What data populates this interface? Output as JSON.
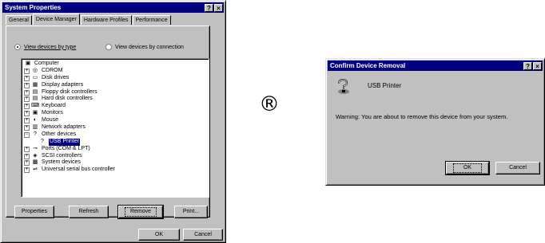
{
  "system_properties": {
    "title": "System Properties",
    "titlebar_buttons": [
      "?",
      "×"
    ],
    "tabs": [
      "General",
      "Device Manager",
      "Hardware Profiles",
      "Performance"
    ],
    "view_options": [
      {
        "label": "View devices by type",
        "checked": true
      },
      {
        "label": "View devices by connection",
        "checked": false
      }
    ],
    "tree": [
      {
        "label": "Computer",
        "expander": "",
        "icon": "computer-icon",
        "level": 0
      },
      {
        "label": "CDROM",
        "expander": "+",
        "icon": "cdrom-icon",
        "level": 1
      },
      {
        "label": "Disk drives",
        "expander": "+",
        "icon": "disk-drive-icon",
        "level": 1
      },
      {
        "label": "Display adapters",
        "expander": "+",
        "icon": "display-adapter-icon",
        "level": 1
      },
      {
        "label": "Floppy disk controllers",
        "expander": "+",
        "icon": "floppy-controller-icon",
        "level": 1
      },
      {
        "label": "Hard disk controllers",
        "expander": "+",
        "icon": "hard-disk-controller-icon",
        "level": 1
      },
      {
        "label": "Keyboard",
        "expander": "+",
        "icon": "keyboard-icon",
        "level": 1
      },
      {
        "label": "Monitors",
        "expander": "+",
        "icon": "monitor-icon",
        "level": 1
      },
      {
        "label": "Mouse",
        "expander": "+",
        "icon": "mouse-icon",
        "level": 1
      },
      {
        "label": "Network adapters",
        "expander": "+",
        "icon": "network-adapter-icon",
        "level": 1
      },
      {
        "label": "Other devices",
        "expander": "−",
        "icon": "unknown-device-icon",
        "level": 1
      },
      {
        "label": "USB Printer",
        "expander": "",
        "icon": "unknown-device-icon",
        "level": 2,
        "selected": true
      },
      {
        "label": "Ports (COM & LPT)",
        "expander": "+",
        "icon": "port-icon",
        "level": 1
      },
      {
        "label": "SCSI controllers",
        "expander": "+",
        "icon": "scsi-icon",
        "level": 1
      },
      {
        "label": "System devices",
        "expander": "+",
        "icon": "system-device-icon",
        "level": 1
      },
      {
        "label": "Universal serial bus controller",
        "expander": "+",
        "icon": "usb-icon",
        "level": 1
      }
    ],
    "buttons": {
      "properties": "Properties",
      "refresh": "Refresh",
      "remove": "Remove",
      "print": "Print...",
      "ok": "OK",
      "cancel": "Cancel"
    }
  },
  "registered_symbol": "®",
  "confirm_dialog": {
    "title": "Confirm Device Removal",
    "titlebar_buttons": [
      "?",
      "×"
    ],
    "device_name": "USB Printer",
    "warning": "Warning: You are about to remove this device from your system.",
    "buttons": {
      "ok": "OK",
      "cancel": "Cancel"
    }
  },
  "colors": {
    "titlebar": "#000080",
    "face": "#c0c0c0",
    "selection": "#000080"
  }
}
